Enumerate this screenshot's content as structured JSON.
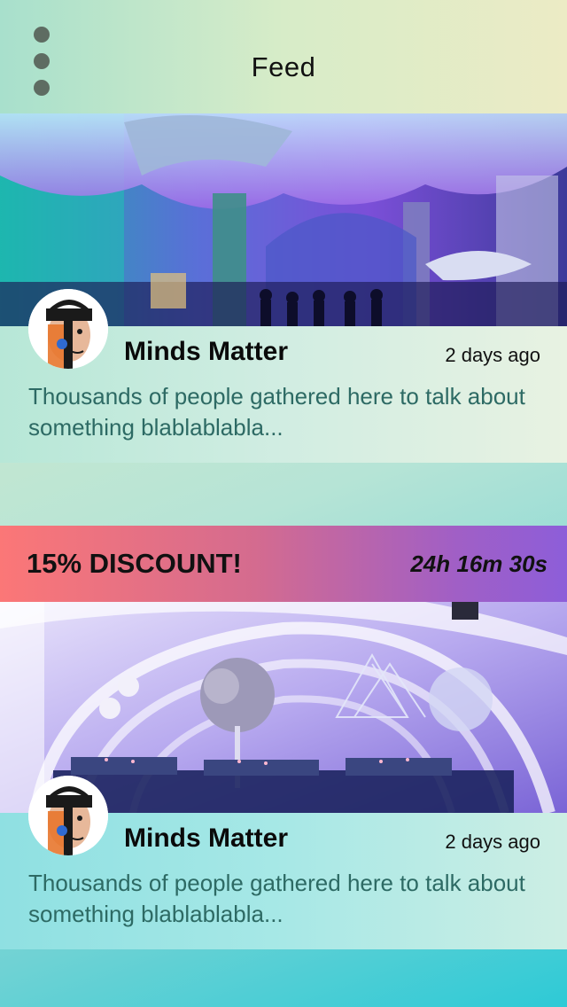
{
  "header": {
    "title": "Feed",
    "menu_icon": "more-vertical-icon"
  },
  "posts": [
    {
      "image": "aquarium-event-photo",
      "author": "Minds Matter",
      "time": "2 days ago",
      "text": "Thousands of people gathered here to talk about something blablablabla..."
    },
    {
      "image": "banquet-hall-photo",
      "author": "Minds Matter",
      "time": "2 days ago",
      "text": "Thousands of people gathered here to talk about something blablablabla..."
    }
  ],
  "promo": {
    "title": "15% DISCOUNT!",
    "timer": "24h 16m 30s"
  },
  "colors": {
    "promo_start": "#fb7777",
    "promo_end": "#8d5ed9",
    "description_text": "#2d6a64",
    "menu_dots": "#5e6c62"
  }
}
